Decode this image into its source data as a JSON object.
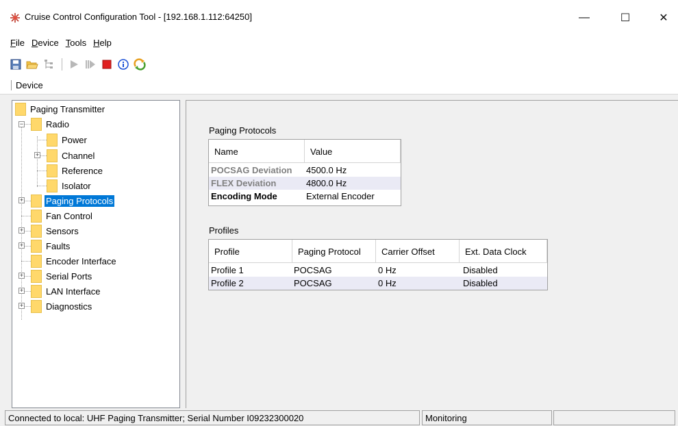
{
  "window": {
    "title": "Cruise Control Configuration Tool - [192.168.1.112:64250]",
    "controls": {
      "minimize": "—",
      "maximize": "☐",
      "close": "✕"
    }
  },
  "menu": [
    {
      "underline": "F",
      "rest": "ile"
    },
    {
      "underline": "D",
      "rest": "evice"
    },
    {
      "underline": "T",
      "rest": "ools"
    },
    {
      "underline": "H",
      "rest": "elp"
    }
  ],
  "toolbar": {
    "icons": [
      "save-icon",
      "open-folder-icon",
      "tree-icon",
      "play-icon",
      "step-icon",
      "stop-icon",
      "info-icon",
      "refresh-icon"
    ],
    "colors": {
      "stop": "#e02020",
      "info": "#1a4fd6",
      "refresh": "#e8a020"
    }
  },
  "tabs": {
    "device": "Device"
  },
  "tree": {
    "root": "Paging Transmitter",
    "radio": "Radio",
    "power": "Power",
    "channel": "Channel",
    "reference": "Reference",
    "isolator": "Isolator",
    "paging_protocols": "Paging Protocols",
    "fan_control": "Fan Control",
    "sensors": "Sensors",
    "faults": "Faults",
    "encoder_interface": "Encoder Interface",
    "serial_ports": "Serial Ports",
    "lan_interface": "LAN Interface",
    "diagnostics": "Diagnostics",
    "selected": "Paging Protocols"
  },
  "paging_protocols": {
    "label": "Paging Protocols",
    "columns": [
      "Name",
      "Value"
    ],
    "rows": [
      {
        "name": "POCSAG Deviation",
        "value": "4500.0 Hz"
      },
      {
        "name": "FLEX Deviation",
        "value": "4800.0 Hz"
      },
      {
        "name": "Encoding Mode",
        "value": "External Encoder"
      }
    ]
  },
  "profiles": {
    "label": "Profiles",
    "columns": [
      "Profile",
      "Paging Protocol",
      "Carrier Offset",
      "Ext. Data Clock"
    ],
    "rows": [
      {
        "profile": "Profile 1",
        "protocol": "POCSAG",
        "offset": "0 Hz",
        "clock": "Disabled"
      },
      {
        "profile": "Profile 2",
        "protocol": "POCSAG",
        "offset": "0 Hz",
        "clock": "Disabled"
      }
    ]
  },
  "status": {
    "connection": "Connected to local: UHF Paging Transmitter; Serial Number I09232300020",
    "mode": "Monitoring",
    "extra": ""
  },
  "colors": {
    "selection": "#0078d7",
    "folder": "#ffd86b",
    "alt_row": "#eaeaf5",
    "grey_label": "#808080"
  }
}
